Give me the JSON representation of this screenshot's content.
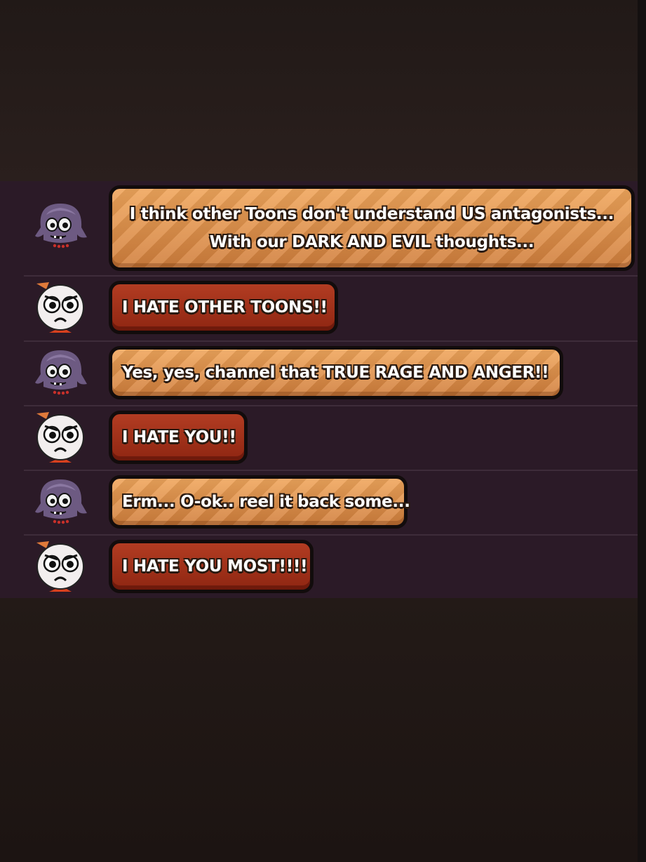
{
  "chat": {
    "messages": [
      {
        "speaker": "purple-toon",
        "style": "orange",
        "lines": [
          "I think other Toons don't understand US antagonists...",
          "With our DARK AND EVIL thoughts..."
        ]
      },
      {
        "speaker": "white-toon",
        "style": "red",
        "lines": [
          "I HATE OTHER TOONS!!"
        ]
      },
      {
        "speaker": "purple-toon",
        "style": "orange",
        "lines": [
          "Yes, yes, channel that TRUE RAGE AND ANGER!!"
        ]
      },
      {
        "speaker": "white-toon",
        "style": "red",
        "lines": [
          "I HATE YOU!!"
        ]
      },
      {
        "speaker": "purple-toon",
        "style": "orange",
        "lines": [
          "Erm... O-ok.. reel it back some..."
        ]
      },
      {
        "speaker": "white-toon",
        "style": "red",
        "lines": [
          "I HATE YOU MOST!!!!"
        ]
      }
    ]
  },
  "colors": {
    "background": "#1f1715",
    "panel": "#2b1a27",
    "orange_bubble": "#e0924b",
    "red_bubble": "#a33219",
    "bubble_border": "#120c0c"
  }
}
